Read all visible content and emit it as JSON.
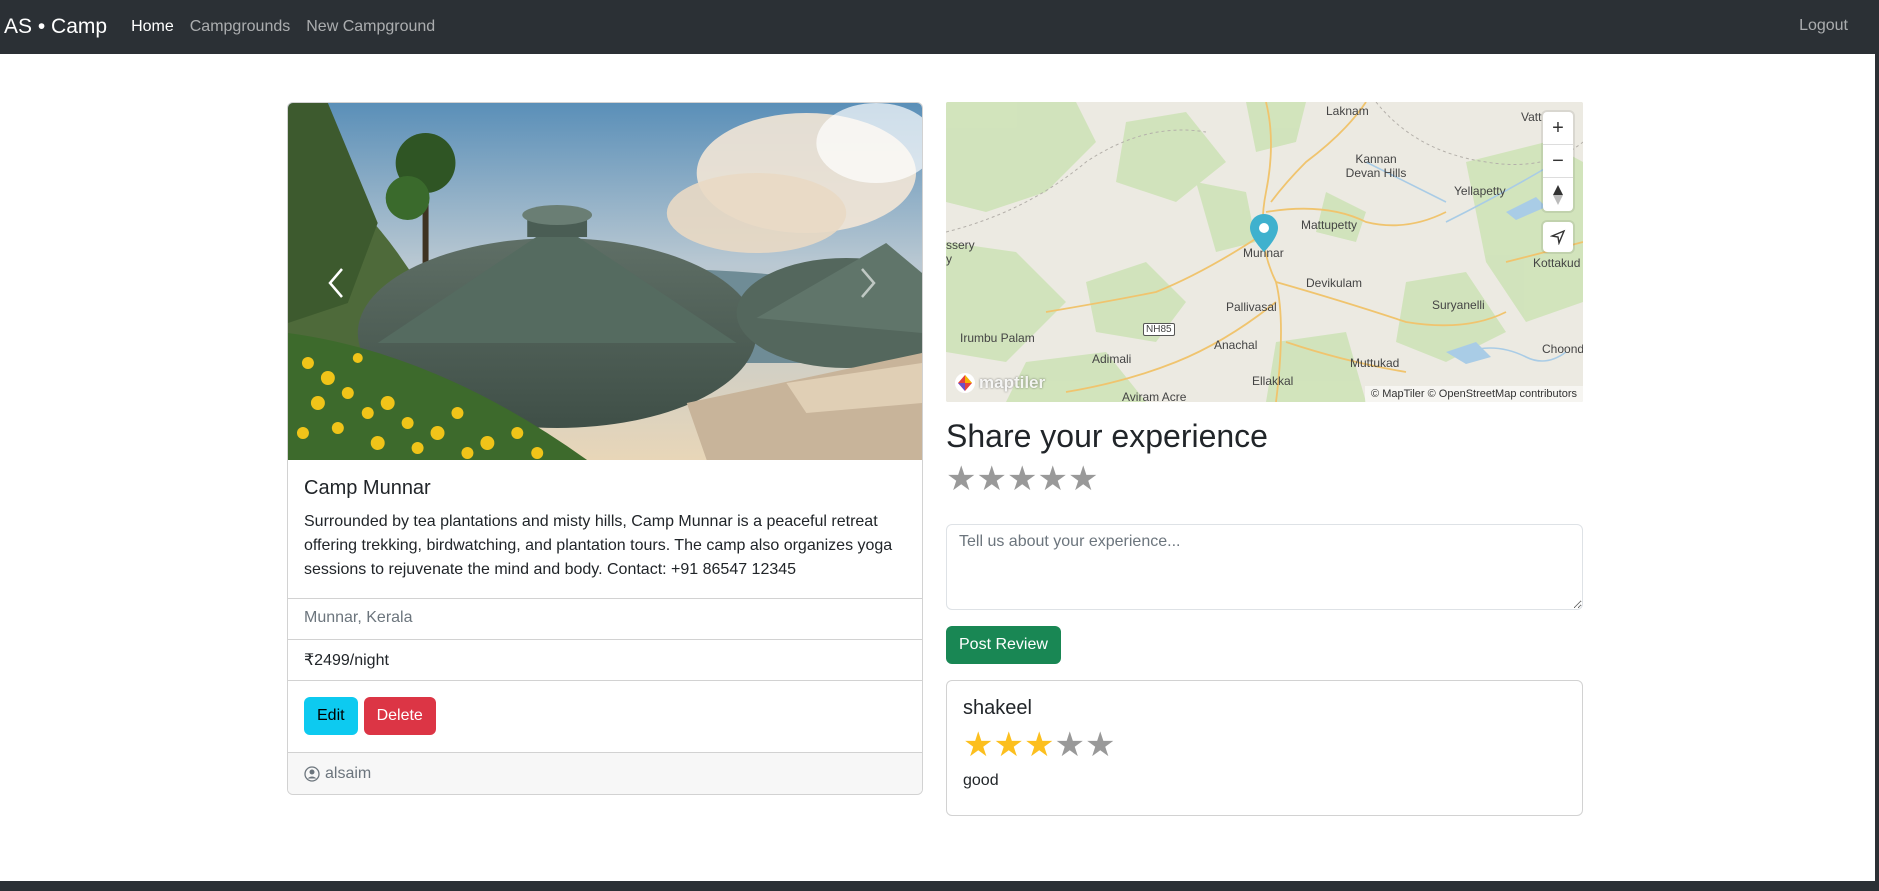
{
  "navbar": {
    "brand": "AS • Camp",
    "links": [
      "Home",
      "Campgrounds",
      "New Campground"
    ],
    "logout": "Logout"
  },
  "campground": {
    "title": "Camp Munnar",
    "description": "Surrounded by tea plantations and misty hills, Camp Munnar is a peaceful retreat offering trekking, birdwatching, and plantation tours. The camp also organizes yoga sessions to rejuvenate the mind and body. Contact: +91 86547 12345",
    "location": "Munnar, Kerala",
    "price": "₹2499/night",
    "edit_label": "Edit",
    "delete_label": "Delete",
    "author": "alsaim"
  },
  "map": {
    "labels": [
      "Laknam",
      "Vatt",
      "Kannan Devan Hills",
      "Yellapetty",
      "Mattupetty",
      "Munnar",
      "ssery",
      "y",
      "Kottakud",
      "Devikulam",
      "Pallivasal",
      "Suryanelli",
      "NH85",
      "Irumbu Palam",
      "Adimali",
      "Anachal",
      "Choondal",
      "Muttukad",
      "Ellakkal",
      "Aviram Acre"
    ],
    "logo_text": "maptiler",
    "attribution": "© MapTiler © OpenStreetMap contributors",
    "zoom_in": "+",
    "zoom_out": "−"
  },
  "review_form": {
    "heading": "Share your experience",
    "placeholder": "Tell us about your experience...",
    "submit_label": "Post Review",
    "rating": 0
  },
  "reviews": [
    {
      "author": "shakeel",
      "rating": 3,
      "max_rating": 5,
      "body": "good"
    }
  ],
  "colors": {
    "navbar": "#2b3035",
    "info": "#0dcaf0",
    "danger": "#dc3545",
    "success": "#198754",
    "star_gold": "#fcbf1e",
    "star_gray": "#999999"
  }
}
